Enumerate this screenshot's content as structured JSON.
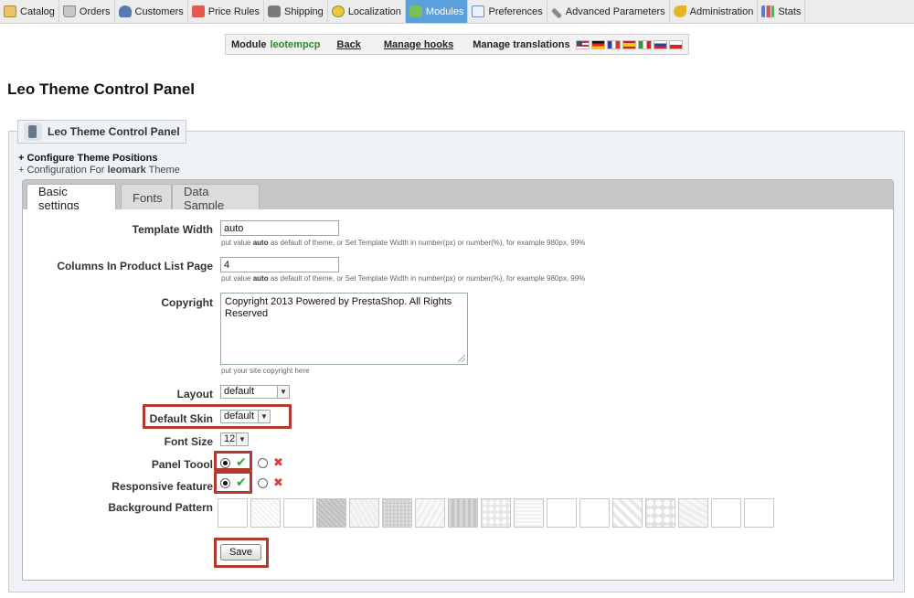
{
  "topmenu": {
    "items": [
      {
        "label": "Catalog",
        "icon": "catalog-icon"
      },
      {
        "label": "Orders",
        "icon": "cart-icon"
      },
      {
        "label": "Customers",
        "icon": "customers-icon"
      },
      {
        "label": "Price Rules",
        "icon": "price-rules-icon"
      },
      {
        "label": "Shipping",
        "icon": "truck-icon"
      },
      {
        "label": "Localization",
        "icon": "globe-icon"
      },
      {
        "label": "Modules",
        "icon": "puzzle-icon",
        "active": true
      },
      {
        "label": "Preferences",
        "icon": "preferences-icon"
      },
      {
        "label": "Advanced Parameters",
        "icon": "wrench-icon"
      },
      {
        "label": "Administration",
        "icon": "key-icon"
      },
      {
        "label": "Stats",
        "icon": "bar-chart-icon"
      }
    ]
  },
  "module_bar": {
    "prefix": "Module",
    "module_name": "leotempcp",
    "back": "Back",
    "manage_hooks": "Manage hooks",
    "manage_translations": "Manage translations",
    "flags": [
      "us-flag-icon",
      "de-flag-icon",
      "fr-flag-icon",
      "es-flag-icon",
      "it-flag-icon",
      "ru-flag-icon",
      "pl-flag-icon"
    ]
  },
  "page_title": "Leo Theme Control Panel",
  "panel": {
    "legend": "Leo Theme Control Panel",
    "info_line1": "+ Configure Theme Positions",
    "info_line2_prefix": "+ Configuration For",
    "info_line2_theme": "leomark",
    "info_line2_suffix": "Theme"
  },
  "tabs": [
    "Basic settings",
    "Fonts",
    "Data Sample"
  ],
  "form": {
    "template_width": {
      "label": "Template Width",
      "value": "auto",
      "hint_pre": "put value",
      "hint_bold": "auto",
      "hint_post": "as default of theme, or Set Template Width in number(px) or number(%), for example 980px, 99%"
    },
    "columns": {
      "label": "Columns In Product List Page",
      "value": "4",
      "hint_pre": "put value",
      "hint_bold": "auto",
      "hint_post": "as default of theme, or Set Template Width in number(px) or number(%), for example 980px, 99%"
    },
    "copyright": {
      "label": "Copyright",
      "value": "Copyright 2013 Powered by PrestaShop. All Rights Reserved",
      "hint": "put your site copyright here"
    },
    "layout": {
      "label": "Layout",
      "value": "default"
    },
    "default_skin": {
      "label": "Default Skin",
      "value": "default"
    },
    "font_size": {
      "label": "Font Size",
      "value": "12"
    },
    "panel_tool": {
      "label": "Panel Toool",
      "selected": "yes"
    },
    "responsive": {
      "label": "Responsive feature",
      "selected": "yes"
    },
    "background_pattern": {
      "label": "Background Pattern",
      "count": 17
    },
    "save": "Save"
  },
  "colors": {
    "active_tab_bg": "#5b9fdb",
    "module_name": "#2a8a2a",
    "highlight_box": "#b03a2e",
    "check": "#2fa52f",
    "cross": "#e03c3c"
  }
}
